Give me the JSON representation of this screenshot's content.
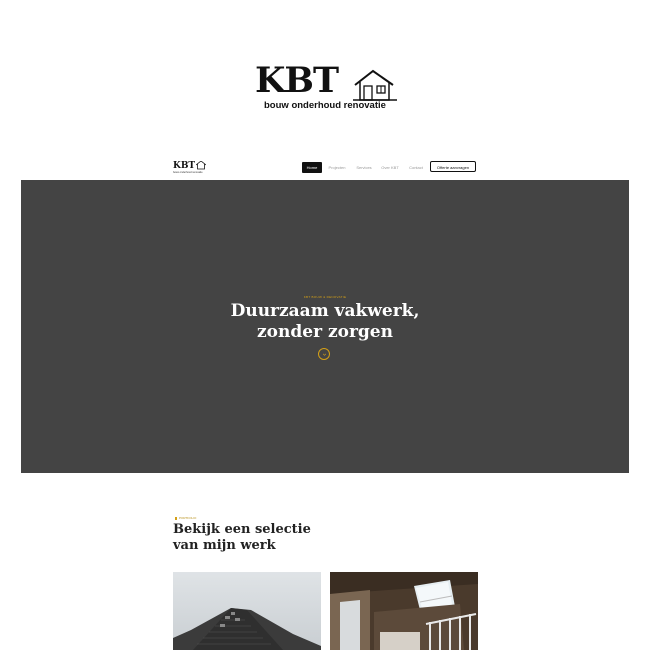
{
  "brand": {
    "name": "KBT",
    "tagline": "bouw onderhoud renovatie"
  },
  "nav": {
    "items": [
      {
        "label": "Home",
        "active": true
      },
      {
        "label": "Projecten",
        "active": false
      },
      {
        "label": "Services",
        "active": false
      },
      {
        "label": "Over KBT",
        "active": false
      },
      {
        "label": "Contact",
        "active": false
      }
    ],
    "cta": "Offerte aanvragen"
  },
  "hero": {
    "eyebrow": "KBT BOUW & RENOVATIE",
    "title_line1": "Duurzaam vakwerk,",
    "title_line2": "zonder zorgen"
  },
  "portfolio": {
    "eyebrow": "PORTFOLIO",
    "title_line1": "Bekijk een selectie",
    "title_line2": "van mijn werk"
  },
  "colors": {
    "accent": "#d4a017",
    "hero_bg": "#444444",
    "text_dark": "#111111"
  },
  "icons": {
    "logo_house": "house-outline-icon",
    "scroll": "scroll-down-icon"
  }
}
